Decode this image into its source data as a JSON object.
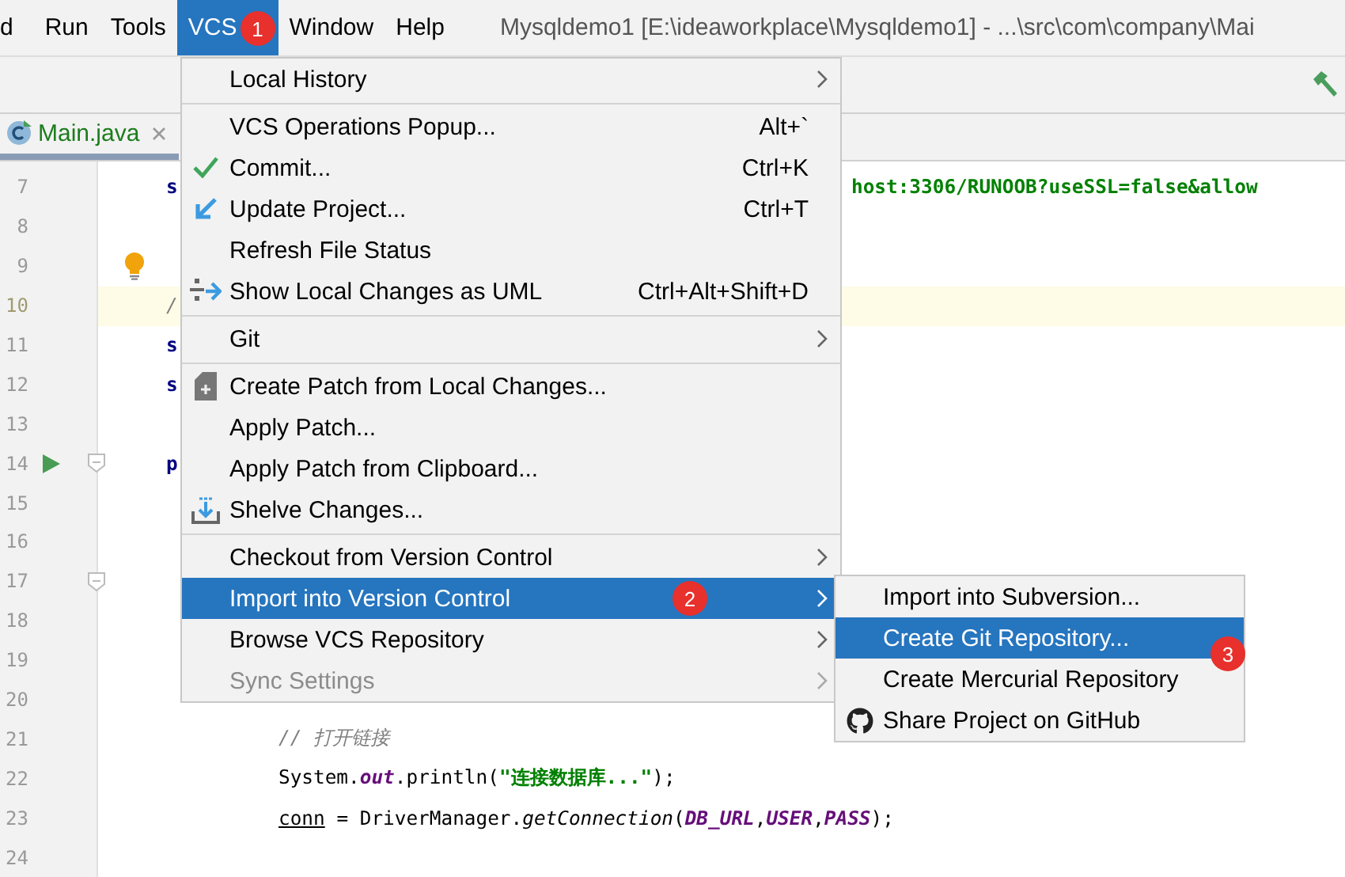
{
  "menu_bar": {
    "items": [
      {
        "label": "d",
        "selected": false
      },
      {
        "label": "Run",
        "selected": false
      },
      {
        "label": "Tools",
        "selected": false
      },
      {
        "label": "VCS",
        "selected": true,
        "badge": "1"
      },
      {
        "label": "Window",
        "selected": false
      },
      {
        "label": "Help",
        "selected": false
      }
    ],
    "title": "Mysqldemo1 [E:\\ideaworkplace\\Mysqldemo1] - ...\\src\\com\\company\\Mai"
  },
  "tab": {
    "label": "Main.java"
  },
  "editor": {
    "lines": [
      {
        "number": "7",
        "highlighted": false,
        "left": [
          {
            "kind": "keyword",
            "text": "s"
          }
        ],
        "right": [
          {
            "kind": "string",
            "text": "host:3306/RUNOOB?useSSL=false&allow"
          }
        ]
      },
      {
        "number": "8",
        "highlighted": false
      },
      {
        "number": "9",
        "highlighted": false,
        "kind": "bulb"
      },
      {
        "number": "10",
        "highlighted": true,
        "left": [
          {
            "kind": "comment",
            "text": "/"
          }
        ]
      },
      {
        "number": "11",
        "highlighted": false,
        "left": [
          {
            "kind": "keyword",
            "text": "s"
          }
        ]
      },
      {
        "number": "12",
        "highlighted": false,
        "left": [
          {
            "kind": "keyword",
            "text": "s"
          }
        ]
      },
      {
        "number": "13",
        "highlighted": false
      },
      {
        "number": "14",
        "highlighted": false,
        "kind": "run",
        "left": [
          {
            "kind": "keyword",
            "text": "p"
          }
        ]
      },
      {
        "number": "15",
        "highlighted": false
      },
      {
        "number": "16",
        "highlighted": false
      },
      {
        "number": "17",
        "highlighted": false,
        "kind": "fold"
      },
      {
        "number": "18",
        "highlighted": false
      },
      {
        "number": "19",
        "highlighted": false
      },
      {
        "number": "20",
        "highlighted": false
      },
      {
        "number": "21",
        "highlighted": false,
        "indented": true,
        "left": [
          {
            "kind": "comment",
            "text": "// 打开链接"
          }
        ]
      },
      {
        "number": "22",
        "highlighted": false,
        "indented": true,
        "left": [
          {
            "kind": "plain",
            "text": "System."
          },
          {
            "kind": "field",
            "text": "out"
          },
          {
            "kind": "plain",
            "text": ".println("
          },
          {
            "kind": "string",
            "text": "\"连接数据库...\""
          },
          {
            "kind": "plain",
            "text": ");"
          }
        ]
      },
      {
        "number": "23",
        "highlighted": false,
        "indented": true,
        "left": [
          {
            "kind": "local",
            "text": "conn"
          },
          {
            "kind": "plain",
            "text": " = DriverManager."
          },
          {
            "kind": "method",
            "text": "getConnection"
          },
          {
            "kind": "plain",
            "text": "("
          },
          {
            "kind": "field",
            "text": "DB_URL"
          },
          {
            "kind": "plain",
            "text": ","
          },
          {
            "kind": "field",
            "text": "USER"
          },
          {
            "kind": "plain",
            "text": ","
          },
          {
            "kind": "field",
            "text": "PASS"
          },
          {
            "kind": "plain",
            "text": ");"
          }
        ]
      },
      {
        "number": "24",
        "highlighted": false
      }
    ]
  },
  "vcs_menu": {
    "items": [
      {
        "kind": "item",
        "label": "Local History",
        "submenu": true,
        "selected": false,
        "disabled": false
      },
      {
        "kind": "separator"
      },
      {
        "kind": "item",
        "label": "VCS Operations Popup...",
        "shortcut": "Alt+`",
        "selected": false,
        "disabled": false
      },
      {
        "kind": "check",
        "label": "Commit...",
        "shortcut": "Ctrl+K",
        "selected": false,
        "disabled": false
      },
      {
        "kind": "update",
        "label": "Update Project...",
        "shortcut": "Ctrl+T",
        "selected": false,
        "disabled": false
      },
      {
        "kind": "item",
        "label": "Refresh File Status",
        "selected": false,
        "disabled": false
      },
      {
        "kind": "diagram",
        "label": "Show Local Changes as UML",
        "shortcut": "Ctrl+Alt+Shift+D",
        "selected": false,
        "disabled": false
      },
      {
        "kind": "separator"
      },
      {
        "kind": "item",
        "label": "Git",
        "submenu": true,
        "selected": false,
        "disabled": false
      },
      {
        "kind": "separator"
      },
      {
        "kind": "patch",
        "label": "Create Patch from Local Changes...",
        "selected": false,
        "disabled": false
      },
      {
        "kind": "item",
        "label": "Apply Patch...",
        "selected": false,
        "disabled": false
      },
      {
        "kind": "item",
        "label": "Apply Patch from Clipboard...",
        "selected": false,
        "disabled": false
      },
      {
        "kind": "shelve",
        "label": "Shelve Changes...",
        "selected": false,
        "disabled": false
      },
      {
        "kind": "separator"
      },
      {
        "kind": "item",
        "label": "Checkout from Version Control",
        "submenu": true,
        "selected": false,
        "disabled": false
      },
      {
        "kind": "item",
        "label": "Import into Version Control",
        "submenu": true,
        "selected": true,
        "disabled": false,
        "badge": "2"
      },
      {
        "kind": "item",
        "label": "Browse VCS Repository",
        "submenu": true,
        "selected": false,
        "disabled": false
      },
      {
        "kind": "item",
        "label": "Sync Settings",
        "submenu": true,
        "selected": false,
        "disabled": true
      }
    ]
  },
  "import_submenu": {
    "items": [
      {
        "kind": "item",
        "label": "Import into Subversion...",
        "selected": false
      },
      {
        "kind": "item",
        "label": "Create Git Repository...",
        "selected": true,
        "badge": "3"
      },
      {
        "kind": "item",
        "label": "Create Mercurial Repository",
        "selected": false
      },
      {
        "kind": "github",
        "label": "Share Project on GitHub",
        "selected": false
      }
    ]
  }
}
